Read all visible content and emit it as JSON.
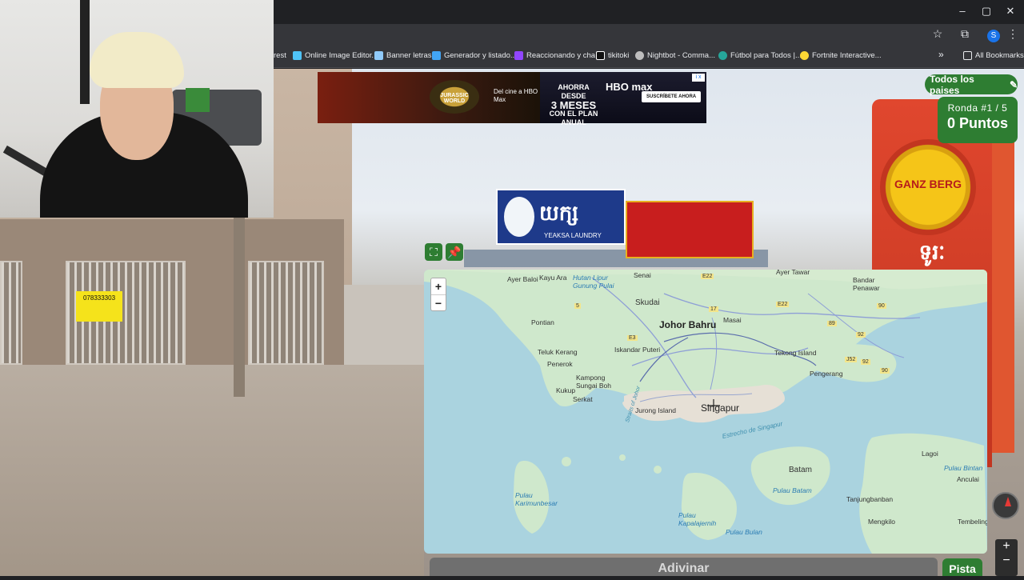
{
  "window_controls": {
    "minimize": "–",
    "maximize": "▢",
    "close": "✕"
  },
  "bookmarks": [
    {
      "label": "rest",
      "color": "#e8eaed"
    },
    {
      "label": "Online Image Editor...",
      "color": "#4fc3f7"
    },
    {
      "label": "Banner letras",
      "color": "#90caf9"
    },
    {
      "label": "Generador y listado...",
      "color": "#42a5f5"
    },
    {
      "label": "Reaccionando y cha...",
      "color": "#9146ff"
    },
    {
      "label": "tikitoki",
      "color": "#ffffff"
    },
    {
      "label": "Nightbot - Comma...",
      "color": "#bdbdbd"
    },
    {
      "label": "Fútbol para Todos |...",
      "color": "#26a69a"
    },
    {
      "label": "Fortnite Interactive...",
      "color": "#fdd835"
    }
  ],
  "bookmarks_overflow": "»",
  "all_bookmarks": "All Bookmarks",
  "profile_initial": "S",
  "ad": {
    "brand": "JURASSIC WORLD",
    "tagline": "Del cine a HBO Max",
    "price_top": "AHORRA DESDE",
    "price_main": "3 MESES",
    "price_bottom": "CON EL PLAN ANUAL",
    "service": "HBO max",
    "cta": "SUSCRÍBETE AHORA",
    "close": "i x"
  },
  "street_signs": {
    "laundry_title": "យក្ស",
    "laundry_sub": "YEAKSA LAUNDRY",
    "tower_brand": "GANZ BERG",
    "tower_kh": "ទូរៈ",
    "shop_phone": "078333303"
  },
  "hud": {
    "filter_label": "Todos los paises",
    "edit_icon": "✎",
    "round_label": "Ronda #1 / 5",
    "points_label": "0 Puntos"
  },
  "map_tools": {
    "expand": "⛶",
    "pin": "📌"
  },
  "zoom": {
    "in": "+",
    "out": "−"
  },
  "map_labels": {
    "ayer_baloi": "Ayer Baloi",
    "kayu_ara": "Kayu Ara",
    "hutan": "Hutan Lipur\nGunung Pulai",
    "senai": "Senai",
    "ayer_tawar": "Ayer Tawar",
    "bandar_penawar": "Bandar\nPenawar",
    "skudai": "Skudai",
    "johor_bahru": "Johor Bahru",
    "masai": "Masai",
    "pontian": "Pontian",
    "iskandar": "Iskandar Puteri",
    "teluk_kerang": "Teluk Kerang",
    "penerok": "Penerok",
    "kampong": "Kampong\nSungai Boh",
    "kukup": "Kukup",
    "serkat": "Serkat",
    "tekong": "Tekong Island",
    "pengerang": "Pengerang",
    "jurong": "Jurong Island",
    "singapur": "Singapur",
    "estrecho": "Estrecho de Singapur",
    "straits_johor": "Straits of Johor",
    "batam": "Batam",
    "pulau_batam": "Pulau Batam",
    "karimunbesar": "Pulau\nKarimunbesar",
    "kapalajernih": "Pulau\nKapalajernih",
    "pulau_bulan": "Pulau Bulan",
    "lagoi": "Lagoi",
    "pulau_bintan": "Pulau Bintan",
    "anculai": "Anculai",
    "tanjungban": "Tanjungbanban",
    "mengkilo": "Mengkilo",
    "tembeling": "Tembeling",
    "road_e22": "E22",
    "road_17": "17",
    "road_5": "5",
    "road_e3": "E3",
    "road_e22b": "E22",
    "road_90": "90",
    "road_89": "89",
    "road_92": "92",
    "road_j52": "J52",
    "road_92b": "92",
    "road_90b": "90"
  },
  "buttons": {
    "guess": "Adivinar",
    "hint": "Pista"
  },
  "streetview_zoom": {
    "in": "+",
    "out": "−"
  }
}
